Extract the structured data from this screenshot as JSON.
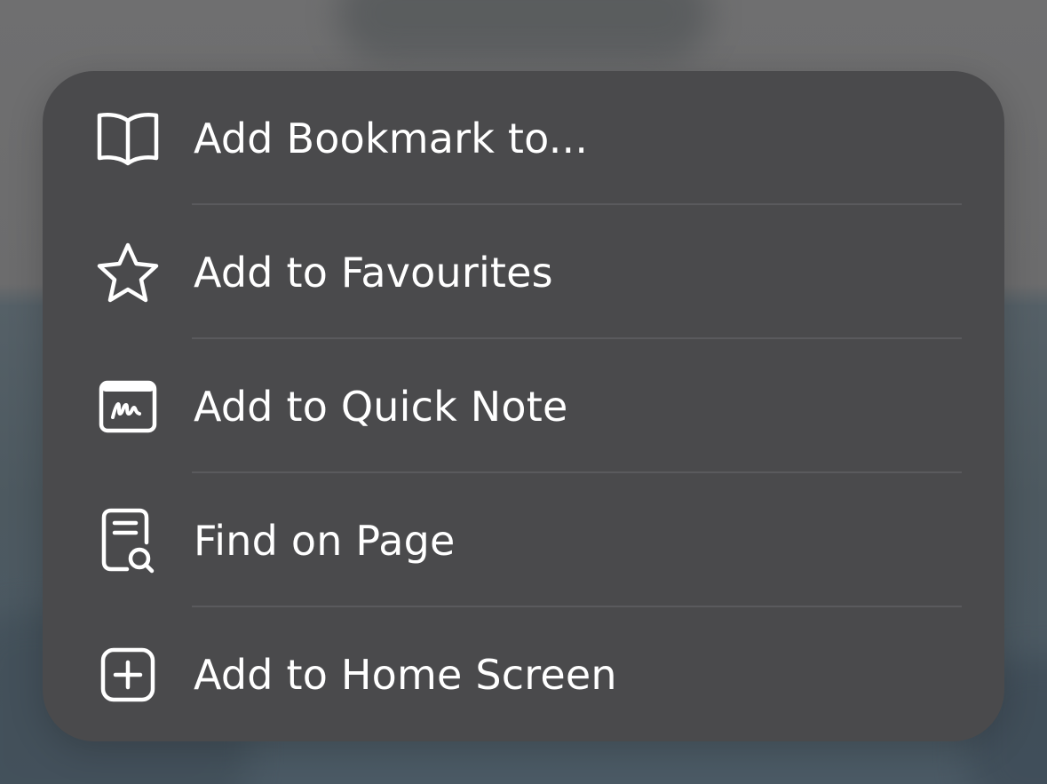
{
  "menu": {
    "items": [
      {
        "label": "Add Bookmark to...",
        "icon": "book-icon"
      },
      {
        "label": "Add to Favourites",
        "icon": "star-icon"
      },
      {
        "label": "Add to Quick Note",
        "icon": "quick-note-icon"
      },
      {
        "label": "Find on Page",
        "icon": "find-on-page-icon"
      },
      {
        "label": "Add to Home Screen",
        "icon": "plus-square-icon"
      }
    ]
  },
  "colors": {
    "menu_background": "#4a4a4c",
    "text": "#ffffff",
    "divider": "#5a5a5d"
  }
}
